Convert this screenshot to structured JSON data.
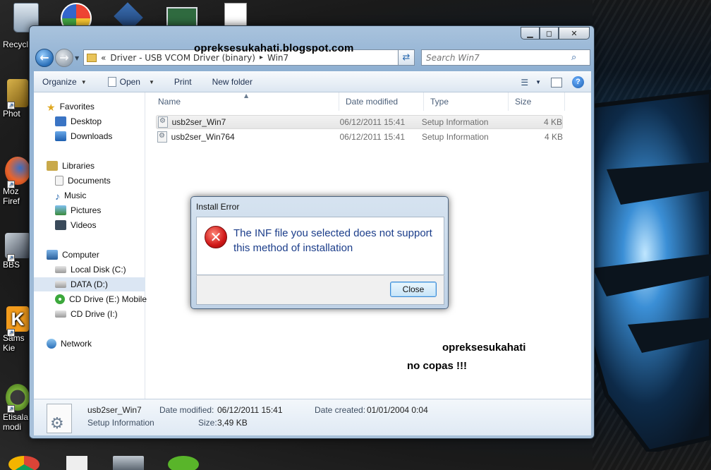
{
  "desktop": {
    "icons": [
      {
        "label": "Recycl",
        "icon": "recycle-bin-icon",
        "color": "#9fb3c8"
      },
      {
        "label": "Phot",
        "icon": "tools-icon",
        "color": "#c9a13a"
      },
      {
        "label": "Moz",
        "label2": "Firef",
        "icon": "firefox-icon",
        "color": "#e8642c"
      },
      {
        "label": "BBS",
        "icon": "bbs-icon",
        "color": "#9aa4ae"
      },
      {
        "label": "Sams",
        "label2": "Kie",
        "icon": "kies-icon",
        "color": "#f29b1c"
      },
      {
        "label": "Etisala",
        "label2": "modi",
        "icon": "modem-icon",
        "color": "#7bb33a"
      }
    ]
  },
  "window": {
    "address": {
      "chevron": "«",
      "segments": [
        "Driver - USB VCOM Driver (binary)",
        "Win7"
      ],
      "separator": "▸"
    },
    "search_placeholder": "Search Win7",
    "toolbar": {
      "organize": "Organize",
      "open": "Open",
      "print": "Print",
      "new_folder": "New folder"
    },
    "nav": {
      "favorites": "Favorites",
      "desktop": "Desktop",
      "downloads": "Downloads",
      "libraries": "Libraries",
      "documents": "Documents",
      "music": "Music",
      "pictures": "Pictures",
      "videos": "Videos",
      "computer": "Computer",
      "local_disk": "Local Disk (C:)",
      "data": "DATA (D:)",
      "cd_e": "CD Drive (E:) Mobile",
      "cd_i": "CD Drive (I:)",
      "network": "Network"
    },
    "columns": {
      "name": "Name",
      "date": "Date modified",
      "type": "Type",
      "size": "Size"
    },
    "files": [
      {
        "name": "usb2ser_Win7",
        "date": "06/12/2011 15:41",
        "type": "Setup Information",
        "size": "4 KB"
      },
      {
        "name": "usb2ser_Win764",
        "date": "06/12/2011 15:41",
        "type": "Setup Information",
        "size": "4 KB"
      }
    ],
    "details": {
      "name": "usb2ser_Win7",
      "type": "Setup Information",
      "date_modified_label": "Date modified:",
      "date_modified": "06/12/2011 15:41",
      "date_created_label": "Date created:",
      "date_created": "01/01/2004 0:04",
      "size_label": "Size:",
      "size": "3,49 KB"
    }
  },
  "dialog": {
    "title": "Install Error",
    "message": "The INF file you selected does not support this method of installation",
    "close_label": "Close"
  },
  "watermarks": {
    "top": "opreksesukahati.blogspot.com",
    "right1": "opreksesukahati",
    "right2": "no copas !!!"
  },
  "colors": {
    "accent": "#1b3d8a",
    "error": "#d01818",
    "selection": "#dbe6f3"
  }
}
